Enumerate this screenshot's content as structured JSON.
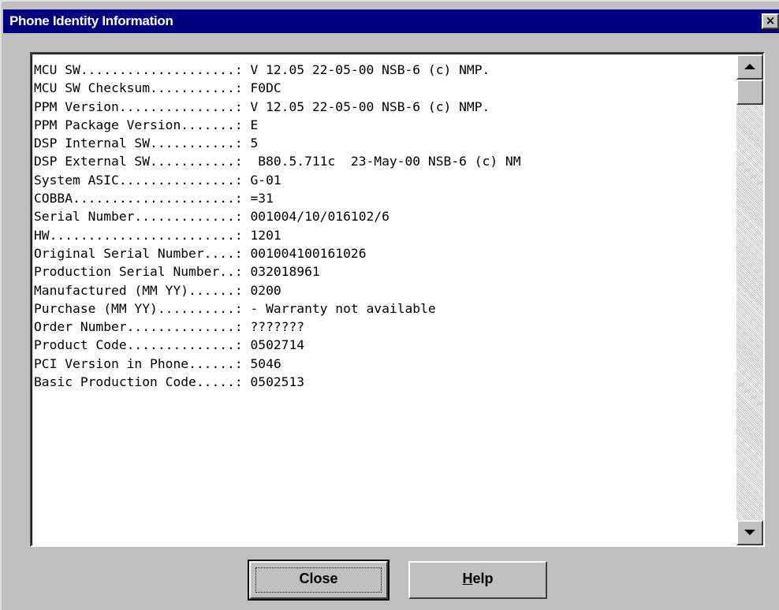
{
  "window": {
    "title": "Phone Identity Information",
    "close_glyph": "×"
  },
  "info_lines": [
    "MCU SW....................: V 12.05 22-05-00 NSB-6 (c) NMP.",
    "MCU SW Checksum...........: F0DC",
    "PPM Version...............: V 12.05 22-05-00 NSB-6 (c) NMP.",
    "PPM Package Version.......: E",
    "DSP Internal SW...........: 5",
    "DSP External SW...........:  B80.5.711c  23-May-00 NSB-6 (c) NM",
    "System ASIC...............: G-01",
    "COBBA.....................: =31",
    "Serial Number.............: 001004/10/016102/6",
    "HW........................: 1201",
    "Original Serial Number....: 001004100161026",
    "Production Serial Number..: 032018961",
    "Manufactured (MM YY)......: 0200",
    "Purchase (MM YY)..........: - Warranty not available",
    "Order Number..............: ???????",
    "Product Code..............: 0502714",
    "PCI Version in Phone......: 5046",
    "Basic Production Code.....: 0502513"
  ],
  "buttons": {
    "close_label": "Close",
    "help_first": "H",
    "help_rest": "elp"
  },
  "icons": {
    "scroll_up": "triangle-up-icon",
    "scroll_down": "triangle-down-icon"
  },
  "colors": {
    "titlebar": "#000080",
    "face": "#c0c0c0"
  }
}
